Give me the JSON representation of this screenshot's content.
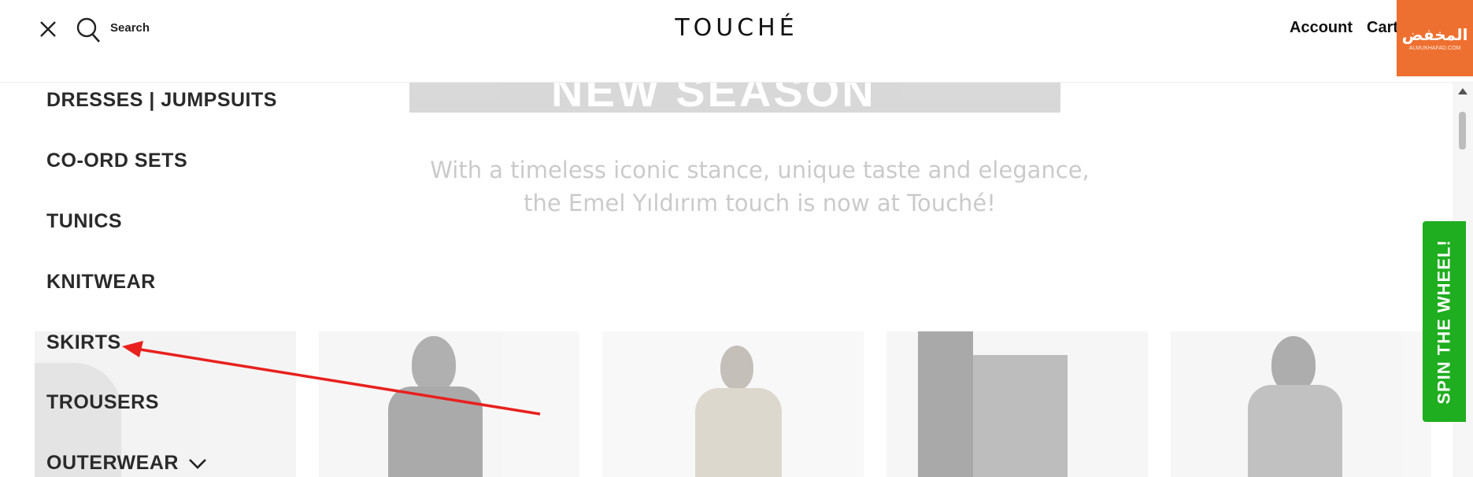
{
  "header": {
    "search_label": "Search",
    "logo": "TOUCHÉ",
    "account_label": "Account",
    "cart_label": "Cart",
    "badge_text": "المخفض",
    "badge_sub": "ALMUKHAFAD.COM"
  },
  "hero": {
    "title": "NEW SEASON",
    "tagline_line1": "With a timeless iconic stance, unique taste and elegance,",
    "tagline_line2": "the Emel Yıldırım touch is now at Touché!"
  },
  "menu": {
    "items": [
      {
        "label": "DRESSES | JUMPSUITS"
      },
      {
        "label": "CO-ORD SETS"
      },
      {
        "label": "TUNICS"
      },
      {
        "label": "KNITWEAR"
      },
      {
        "label": "SKIRTS"
      },
      {
        "label": "TROUSERS"
      },
      {
        "label": "OUTERWEAR"
      }
    ]
  },
  "spin_wheel": {
    "label": "SPIN THE WHEEL!"
  },
  "colors": {
    "badge": "#ee7030",
    "spin": "#1fae1f",
    "arrow": "#e8201e"
  }
}
